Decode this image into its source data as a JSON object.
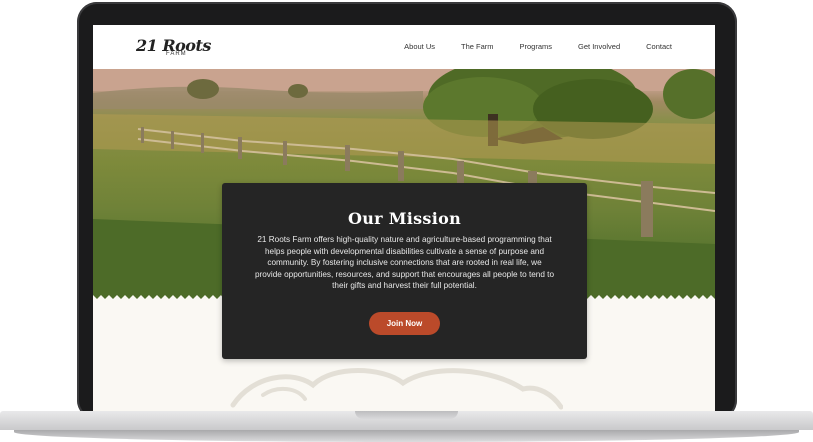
{
  "logo": {
    "main": "21 Roots",
    "sub": "FARM"
  },
  "nav": {
    "items": [
      {
        "label": "About Us"
      },
      {
        "label": "The Farm"
      },
      {
        "label": "Programs"
      },
      {
        "label": "Get Involved"
      },
      {
        "label": "Contact"
      }
    ]
  },
  "mission": {
    "title": "Our Mission",
    "body": "21 Roots Farm offers high-quality nature and agriculture-based programming that helps people with developmental disabilities cultivate a sense of purpose and community. By fostering inclusive connections that are rooted in real life, we provide opportunities, resources, and support that encourages all people to tend to their gifts and harvest their full potential.",
    "cta_label": "Join Now"
  },
  "colors": {
    "accent": "#bb4a2a",
    "card": "#252525",
    "page_bg": "#faf8f3"
  }
}
